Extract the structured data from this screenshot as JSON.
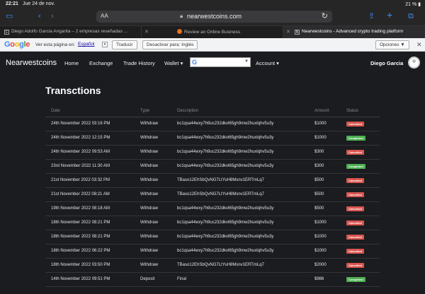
{
  "status_bar": {
    "time": "22:21",
    "date": "Jue 24 de nov.",
    "right": "21 % ▮"
  },
  "browser": {
    "aa": "AA",
    "url": "nearwestcoins.com",
    "tabs": [
      {
        "label": "Diego Adolfo Garcia Angarita – 2 empresas reseñadas ..."
      },
      {
        "label": "Review an Online Business"
      },
      {
        "label": "Nearwestcoins - Advanced crypto trading platform"
      }
    ]
  },
  "translate_bar": {
    "prompt": "Ver esta página en:",
    "language": "Español",
    "translate_btn": "Traducir",
    "disable_btn": "Desactivar para: Inglés",
    "options_btn": "Opciones ▼",
    "close": "✕"
  },
  "nav": {
    "brand": "Nearwestcoins",
    "items": [
      "Home",
      "Exchange",
      "Trade History",
      "Wallet ▾",
      "Account ▾"
    ],
    "user": "Diego Garcia"
  },
  "page": {
    "title": "Transctions"
  },
  "table": {
    "headers": {
      "date": "Date",
      "type": "Type",
      "description": "Description",
      "amount": "Amount",
      "status": "Status"
    },
    "rows": [
      {
        "date": "24th November 2022 03:16 PM",
        "type": "Withdraw",
        "description": "bc1qsa44wxy7h9uc232dkvl65gh9mw2huxlqhv5u3y",
        "amount": "$1000",
        "status": "Cancelled"
      },
      {
        "date": "24th November 2022 12:15 PM",
        "type": "Withdraw",
        "description": "bc1qsa44wxy7h9uc232dkvl65gh9mw2huxlqhv5u3y",
        "amount": "$1000",
        "status": "Completed"
      },
      {
        "date": "24th November 2022 09:53 AM",
        "type": "Withdraw",
        "description": "bc1qsa44wxy7h9uc232dkvl65gh9mw2huxlqhv5u3y",
        "amount": "$300",
        "status": "Cancelled"
      },
      {
        "date": "23rd November 2022 11:30 AM",
        "type": "Withdraw",
        "description": "bc1qsa44wxy7h9uc232dkvl65gh9mw2huxlqhv5u3y",
        "amount": "$300",
        "status": "Completed"
      },
      {
        "date": "21st November 2022 03:32 PM",
        "type": "Withdraw",
        "description": "TBaso12EhSbQvNG7LtYuH8Msnv1ERTmLq7",
        "amount": "$500",
        "status": "Cancelled"
      },
      {
        "date": "21st November 2022 08:21 AM",
        "type": "Withdraw",
        "description": "TBaso12EhSbQvNG7LtYuH8Msnv1ERTmLq7",
        "amount": "$500",
        "status": "Cancelled"
      },
      {
        "date": "19th November 2022 08:18 AM",
        "type": "Withdraw",
        "description": "bc1qsa44wxy7h9uc232dkvl65gh9mw2huxlqhv5u3y",
        "amount": "$500",
        "status": "Cancelled"
      },
      {
        "date": "18th November 2022 08:21 PM",
        "type": "Withdraw",
        "description": "bc1qsa44wxy7h9uc232dkvl65gh9mw2huxlqhv5u3y",
        "amount": "$1000",
        "status": "Cancelled"
      },
      {
        "date": "18th November 2022 08:21 PM",
        "type": "Withdraw",
        "description": "bc1qsa44wxy7h9uc232dkvl65gh9mw2huxlqhv5u3y",
        "amount": "$1000",
        "status": "Cancelled"
      },
      {
        "date": "18th November 2022 06:22 PM",
        "type": "Withdraw",
        "description": "bc1qsa44wxy7h9uc232dkvl65gh9mw2huxlqhv5u3y",
        "amount": "$1000",
        "status": "Cancelled"
      },
      {
        "date": "18th November 2022 03:50 PM",
        "type": "Withdraw",
        "description": "TBaso12EhSbQvNG7LtYuH8Msnv1ERTmLq7",
        "amount": "$2000",
        "status": "Cancelled"
      },
      {
        "date": "14th November 2022 09:51 PM",
        "type": "Deposit",
        "description": "Final",
        "amount": "$986",
        "status": "Completed"
      }
    ]
  },
  "colors": {
    "cancelled": "#d9534f",
    "completed": "#4caf50",
    "safari_accent": "#3d8ef7"
  }
}
